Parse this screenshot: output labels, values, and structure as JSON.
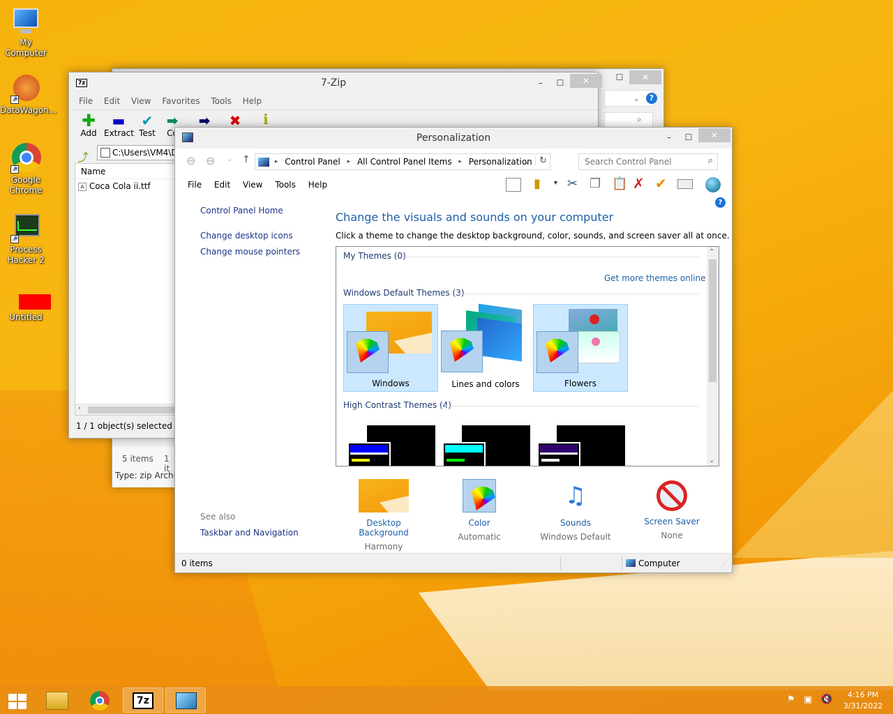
{
  "desktop": {
    "icons": [
      {
        "label": "My Computer"
      },
      {
        "label": "DataWagon..."
      },
      {
        "label": "Google Chrome"
      },
      {
        "label": "Process Hacker 2"
      },
      {
        "label": "Untitled"
      }
    ]
  },
  "bgwin": {
    "path_suffix": "?"
  },
  "zip": {
    "title": "7-Zip",
    "menu": [
      "File",
      "Edit",
      "View",
      "Favorites",
      "Tools",
      "Help"
    ],
    "toolbar": [
      "Add",
      "Extract",
      "Test",
      "Co"
    ],
    "path": "C:\\Users\\VM4\\D",
    "column_name": "Name",
    "files": [
      "Coca Cola ii.ttf"
    ],
    "status": "1 / 1 object(s) selected"
  },
  "explorer_status": {
    "items": "5 items",
    "items2": "1 it",
    "type": "Type: zip Archive"
  },
  "personalization": {
    "title": "Personalization",
    "breadcrumb": [
      "Control Panel",
      "All Control Panel Items",
      "Personalization"
    ],
    "search_placeholder": "Search Control Panel",
    "menu": [
      "File",
      "Edit",
      "View",
      "Tools",
      "Help"
    ],
    "left_links": {
      "home": "Control Panel Home",
      "desktop_icons": "Change desktop icons",
      "mouse": "Change mouse pointers",
      "see_also": "See also",
      "taskbar": "Taskbar and Navigation"
    },
    "heading": "Change the visuals and sounds on your computer",
    "subheading": "Click a theme to change the desktop background, color, sounds, and screen saver all at once.",
    "my_themes": "My Themes (0)",
    "get_more": "Get more themes online",
    "default_themes": "Windows Default Themes (3)",
    "themes": [
      "Windows",
      "Lines and colors",
      "Flowers"
    ],
    "high_contrast": "High Contrast Themes (4)",
    "bottom": [
      {
        "label": "Desktop Background",
        "value": "Harmony"
      },
      {
        "label": "Color",
        "value": "Automatic"
      },
      {
        "label": "Sounds",
        "value": "Windows Default"
      },
      {
        "label": "Screen Saver",
        "value": "None"
      }
    ],
    "status_items": "0 items",
    "status_computer": "Computer"
  },
  "taskbar": {
    "time": "4:16 PM",
    "date": "3/31/2022"
  },
  "colors": {
    "accent": "#1e5fa8",
    "desktop": "#f6b30e"
  }
}
